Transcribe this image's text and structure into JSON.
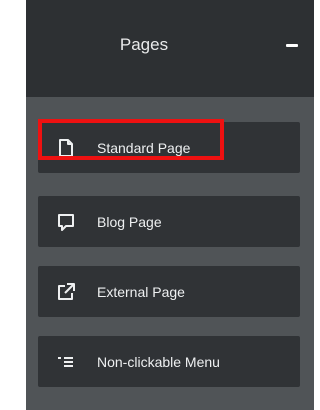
{
  "panel": {
    "title": "Pages",
    "collapse_icon": "minus-icon"
  },
  "menu": {
    "items": [
      {
        "label": "Standard Page",
        "icon": "document-icon",
        "highlighted": true
      },
      {
        "label": "Blog Page",
        "icon": "comment-icon",
        "highlighted": false
      },
      {
        "label": "External Page",
        "icon": "external-link-icon",
        "highlighted": false
      },
      {
        "label": "Non-clickable Menu",
        "icon": "indented-list-icon",
        "highlighted": false
      }
    ]
  },
  "colors": {
    "header_bg": "#2d3033",
    "panel_bg": "#505457",
    "item_bg": "#303336",
    "text": "#eef0f1",
    "highlight": "#ee1111"
  }
}
